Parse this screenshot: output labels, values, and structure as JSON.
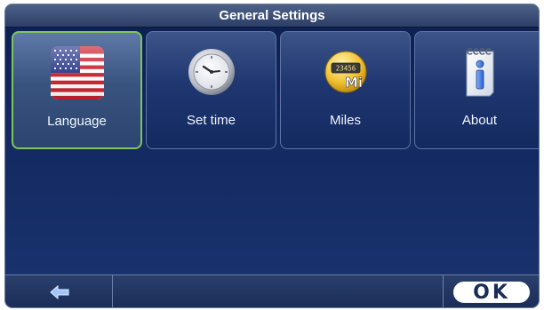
{
  "header": {
    "title": "General Settings"
  },
  "tiles": [
    {
      "label": "Language",
      "icon": "us-flag-icon",
      "selected": true
    },
    {
      "label": "Set time",
      "icon": "clock-icon",
      "selected": false
    },
    {
      "label": "Miles",
      "icon": "odometer-miles-icon",
      "icon_text": "23456",
      "icon_badge": "Mi",
      "selected": false
    },
    {
      "label": "About",
      "icon": "info-notepad-icon",
      "icon_text": "i",
      "selected": false
    }
  ],
  "footer": {
    "back_icon": "back-arrow-icon",
    "ok_label": "OK"
  },
  "colors": {
    "selected_border": "#7fc460",
    "background": "#13285f",
    "ok_button_bg": "#ffffff"
  }
}
